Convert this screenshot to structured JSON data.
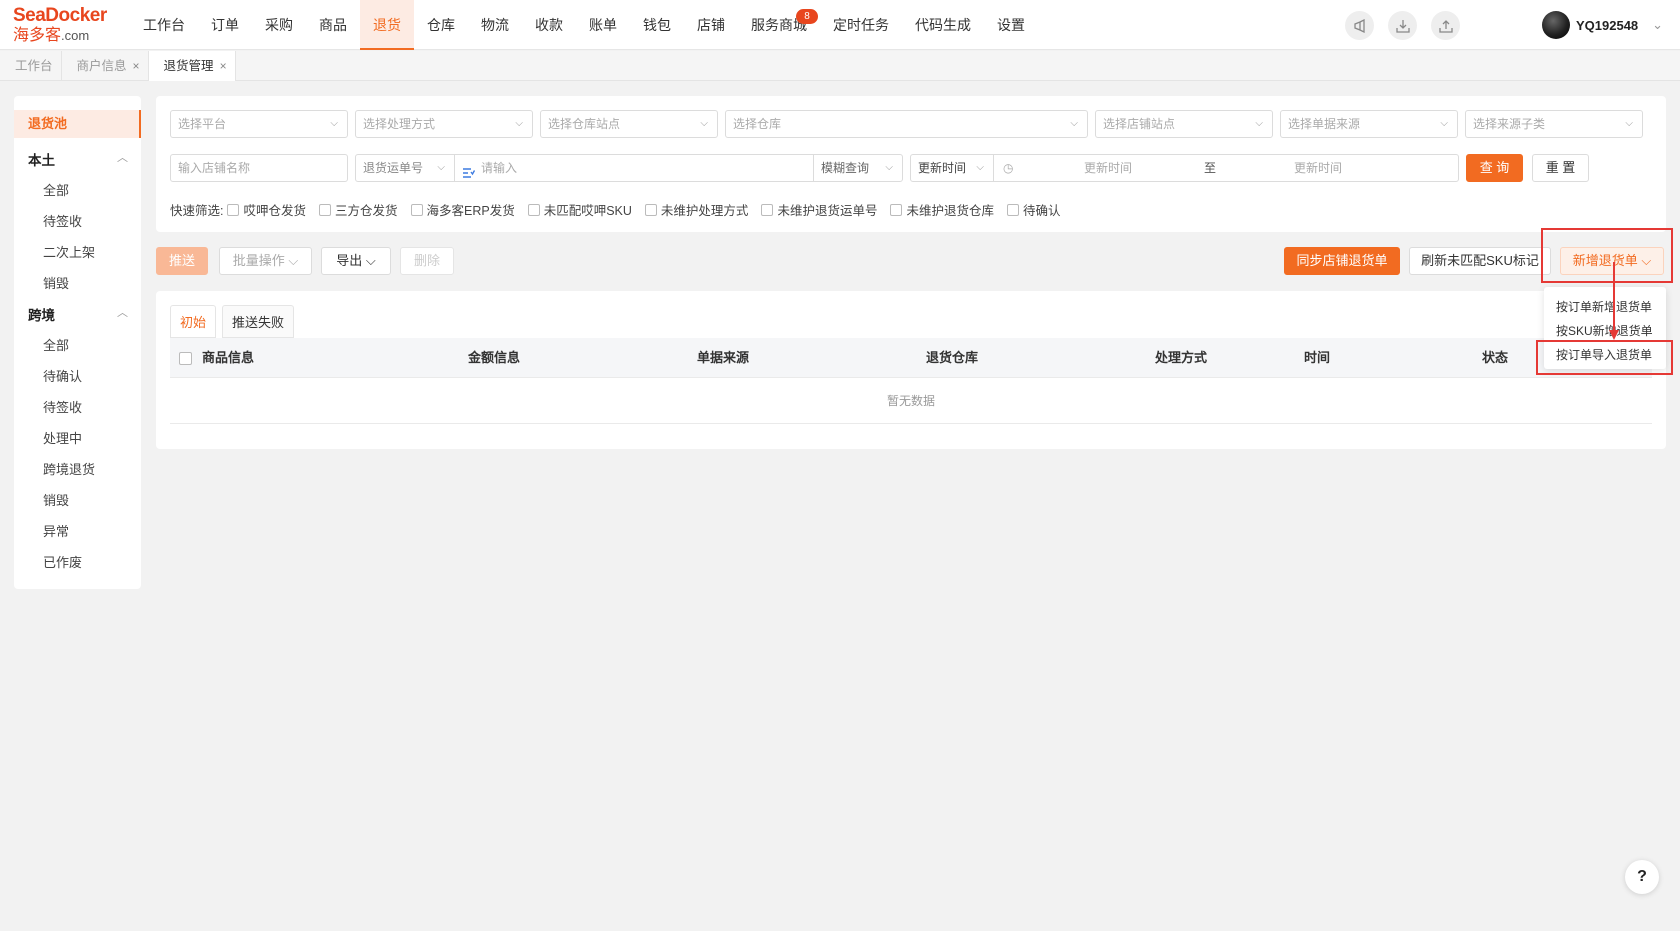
{
  "brand": {
    "name": "SeaDocker",
    "cn": "海多客",
    "domain": ".com",
    "accent": "#f26b21"
  },
  "nav": {
    "items": [
      {
        "label": "工作台"
      },
      {
        "label": "订单"
      },
      {
        "label": "采购"
      },
      {
        "label": "商品"
      },
      {
        "label": "退货",
        "active": true
      },
      {
        "label": "仓库"
      },
      {
        "label": "物流"
      },
      {
        "label": "收款"
      },
      {
        "label": "账单"
      },
      {
        "label": "钱包"
      },
      {
        "label": "店铺"
      },
      {
        "label": "服务商城"
      },
      {
        "label": "定时任务"
      },
      {
        "label": "代码生成"
      },
      {
        "label": "设置"
      }
    ],
    "badge": "8"
  },
  "user": {
    "name": "YQ192548"
  },
  "tabs": [
    {
      "label": "工作台",
      "closable": false
    },
    {
      "label": "商户信息",
      "closable": true
    },
    {
      "label": "退货管理",
      "closable": true,
      "active": true
    }
  ],
  "sidebar": {
    "active": "退货池",
    "groups": [
      {
        "label": "本土",
        "items": [
          "全部",
          "待签收",
          "二次上架",
          "销毁"
        ]
      },
      {
        "label": "跨境",
        "items": [
          "全部",
          "待确认",
          "待签收",
          "处理中",
          "跨境退货",
          "销毁",
          "异常",
          "已作废"
        ]
      }
    ]
  },
  "filters": {
    "row1": [
      "选择平台",
      "选择处理方式",
      "选择仓库站点",
      "选择仓库",
      "选择店铺站点",
      "选择单据来源",
      "选择来源子类"
    ],
    "store_name_placeholder": "输入店铺名称",
    "tracking_type": "退货运单号",
    "search_placeholder": "请输入",
    "match_mode": "模糊查询",
    "time_type": "更新时间",
    "date_start_placeholder": "更新时间",
    "date_sep": "至",
    "date_end_placeholder": "更新时间",
    "query_label": "查 询",
    "reset_label": "重 置",
    "quick_label": "快速筛选:",
    "quick": [
      "哎呷仓发货",
      "三方仓发货",
      "海多客ERP发货",
      "未匹配哎呷SKU",
      "未维护处理方式",
      "未维护退货运单号",
      "未维护退货仓库",
      "待确认"
    ]
  },
  "toolbar": {
    "push": "推送",
    "batch": "批量操作",
    "export": "导出",
    "delete": "删除",
    "sync": "同步店铺退货单",
    "refresh": "刷新未匹配SKU标记",
    "new_return": "新增退货单"
  },
  "new_return_menu": [
    "按订单新增退货单",
    "按SKU新增退货单",
    "按订单导入退货单"
  ],
  "table": {
    "tabs": [
      "初始",
      "推送失败"
    ],
    "columns": [
      "商品信息",
      "金额信息",
      "单据来源",
      "退货仓库",
      "处理方式",
      "时间",
      "状态"
    ],
    "empty": "暂无数据"
  },
  "help": "?"
}
